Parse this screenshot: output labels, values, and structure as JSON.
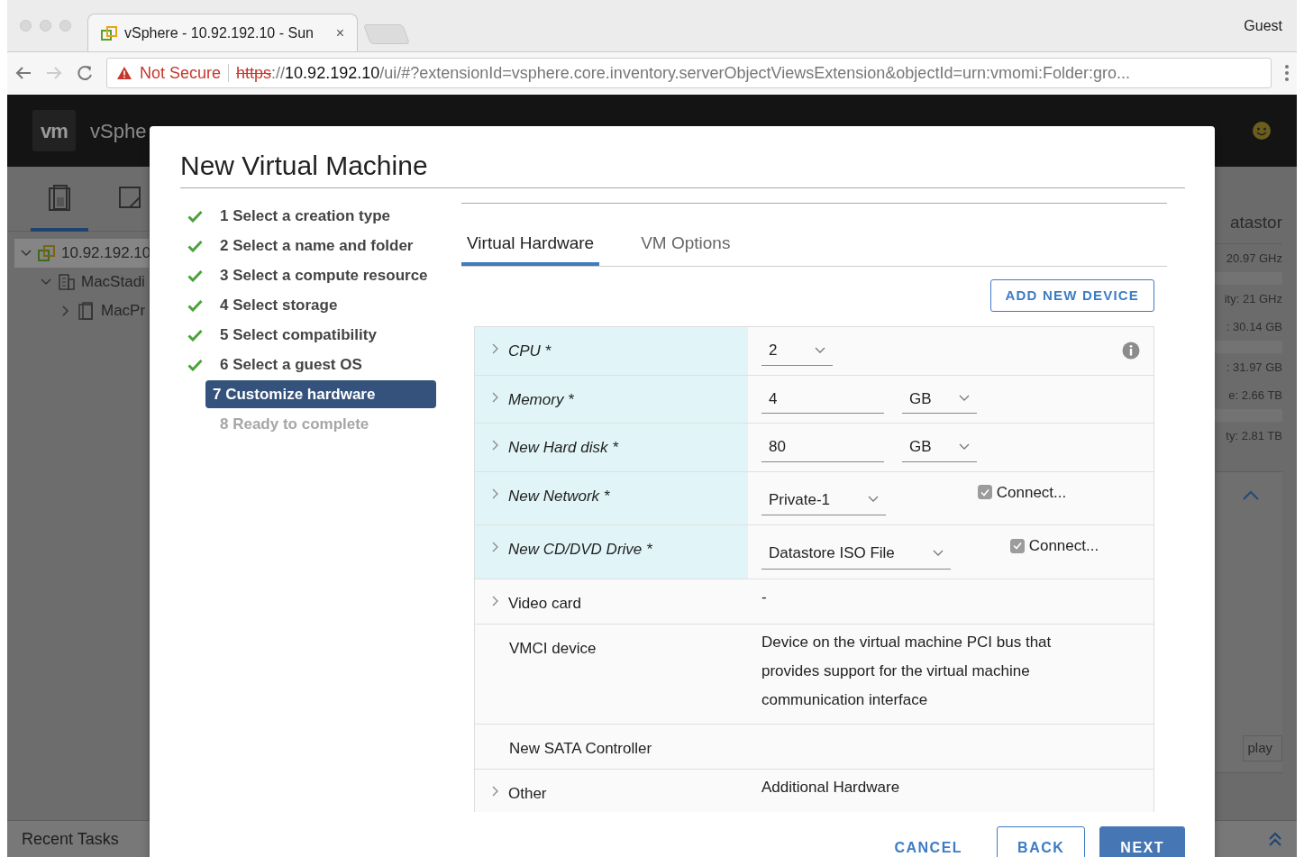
{
  "browser": {
    "tab_title": "vSphere - 10.92.192.10 - Sun",
    "close_glyph": "×",
    "profile": "Guest",
    "security_label": "Not Secure",
    "url_scheme": "https",
    "url_separator": "://",
    "url_host": "10.92.192.10",
    "url_path": "/ui/#?extensionId=vsphere.core.inventory.serverObjectViewsExtension&objectId=urn:vmomi:Folder:gro..."
  },
  "app": {
    "logo": "vm",
    "product": "vSphe",
    "side_tabs": [
      {
        "kind": "hosts",
        "selected": true
      },
      {
        "kind": "vms",
        "selected": false
      }
    ],
    "tree": [
      {
        "label": "10.92.192.10",
        "kind": "vcenter",
        "expanded": true,
        "selected": true,
        "children": [
          {
            "label": "MacStadi",
            "kind": "datacenter",
            "expanded": true,
            "selected": false,
            "children": [
              {
                "label": "MacPr",
                "kind": "host",
                "expanded": false,
                "selected": false
              }
            ]
          }
        ]
      }
    ],
    "summary_heading": "atastor",
    "resources": [
      {
        "top": "20.97 GHz",
        "bottom": "ity: 21 GHz"
      },
      {
        "top": ": 30.14 GB",
        "bottom": ": 31.97 GB"
      },
      {
        "top": "e: 2.66 TB",
        "bottom": "ty: 2.81 TB"
      }
    ],
    "panel_button": "play",
    "recent_tasks": "Recent Tasks"
  },
  "dialog": {
    "title": "New Virtual Machine",
    "steps": [
      {
        "label": "1 Select a creation type",
        "kind": "done"
      },
      {
        "label": "2 Select a name and folder",
        "kind": "done"
      },
      {
        "label": "3 Select a compute resource",
        "kind": "done"
      },
      {
        "label": "4 Select storage",
        "kind": "done"
      },
      {
        "label": "5 Select compatibility",
        "kind": "done"
      },
      {
        "label": "6 Select a guest OS",
        "kind": "done"
      },
      {
        "label": "7 Customize hardware",
        "kind": "current"
      },
      {
        "label": "8 Ready to complete",
        "kind": "pending"
      }
    ],
    "tabs": [
      {
        "label": "Virtual Hardware",
        "selected": true
      },
      {
        "label": "VM Options",
        "selected": false
      }
    ],
    "add_button": "ADD NEW DEVICE",
    "hardware": [
      {
        "label": "CPU *",
        "kind": "select",
        "highlighted": true,
        "expandable": true,
        "value": "2",
        "info": true
      },
      {
        "label": "Memory *",
        "kind": "input_unit",
        "highlighted": true,
        "expandable": true,
        "value": "4",
        "unit": "GB"
      },
      {
        "label": "New Hard disk *",
        "kind": "input_unit",
        "highlighted": true,
        "expandable": true,
        "value": "80",
        "unit": "GB"
      },
      {
        "label": "New Network *",
        "kind": "select_connect",
        "highlighted": true,
        "expandable": true,
        "value": "Private-1",
        "connect": "Connect...",
        "checked": true
      },
      {
        "label": "New CD/DVD Drive *",
        "kind": "select_connect",
        "highlighted": true,
        "expandable": true,
        "value": "Datastore ISO File",
        "connect": "Connect...",
        "checked": true
      },
      {
        "label": "Video card",
        "kind": "text",
        "highlighted": false,
        "expandable": true,
        "value": "-"
      },
      {
        "label": "VMCI device",
        "kind": "text",
        "highlighted": false,
        "expandable": false,
        "value": "Device on the virtual machine PCI bus that provides support for the virtual machine communication interface"
      },
      {
        "label": "New SATA Controller",
        "kind": "text",
        "highlighted": false,
        "expandable": false
      },
      {
        "label": "Other",
        "kind": "text",
        "highlighted": false,
        "expandable": true,
        "value": "Additional Hardware"
      }
    ],
    "buttons": [
      {
        "label": "CANCEL",
        "kind": "link"
      },
      {
        "label": "BACK",
        "kind": "outline"
      },
      {
        "label": "NEXT",
        "kind": "primary"
      }
    ]
  }
}
